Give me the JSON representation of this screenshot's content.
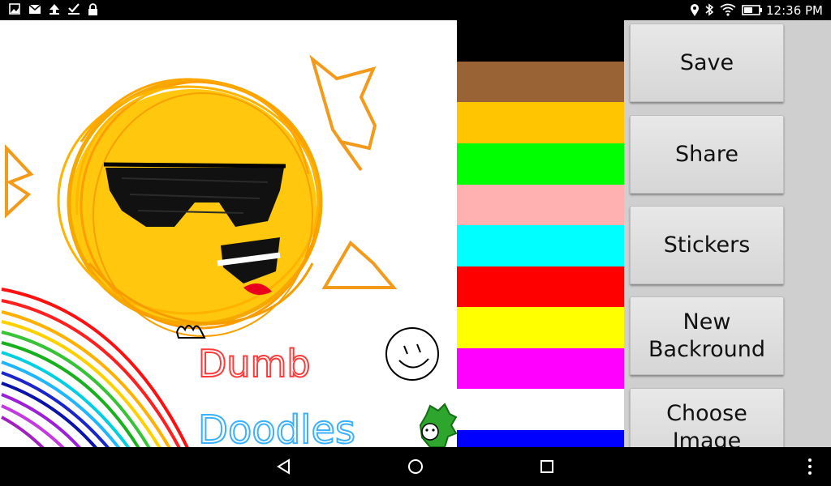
{
  "status_bar": {
    "left_icons": [
      "image-icon",
      "mail-icon",
      "upload-icon",
      "download-done-icon",
      "lock-icon"
    ],
    "right_icons": [
      "location-icon",
      "bluetooth-icon",
      "wifi-icon",
      "battery-icon"
    ],
    "time": "12:36 PM"
  },
  "canvas": {
    "background": "#ffffff",
    "doodle_text": [
      "Dumb",
      "Doodles"
    ]
  },
  "palette": {
    "colors": [
      "#000000",
      "#9a6336",
      "#ffc600",
      "#00ff00",
      "#ffb0b0",
      "#00ffff",
      "#ff0000",
      "#ffff00",
      "#ff00ff",
      "#ffffff",
      "#0000ff"
    ]
  },
  "buttons": {
    "save": "Save",
    "share": "Share",
    "stickers": "Stickers",
    "new_background": "New\nBackround",
    "choose_image": "Choose\nImage"
  },
  "nav_bar": {
    "icons": [
      "back-icon",
      "home-icon",
      "recents-icon",
      "overflow-menu-icon"
    ]
  }
}
